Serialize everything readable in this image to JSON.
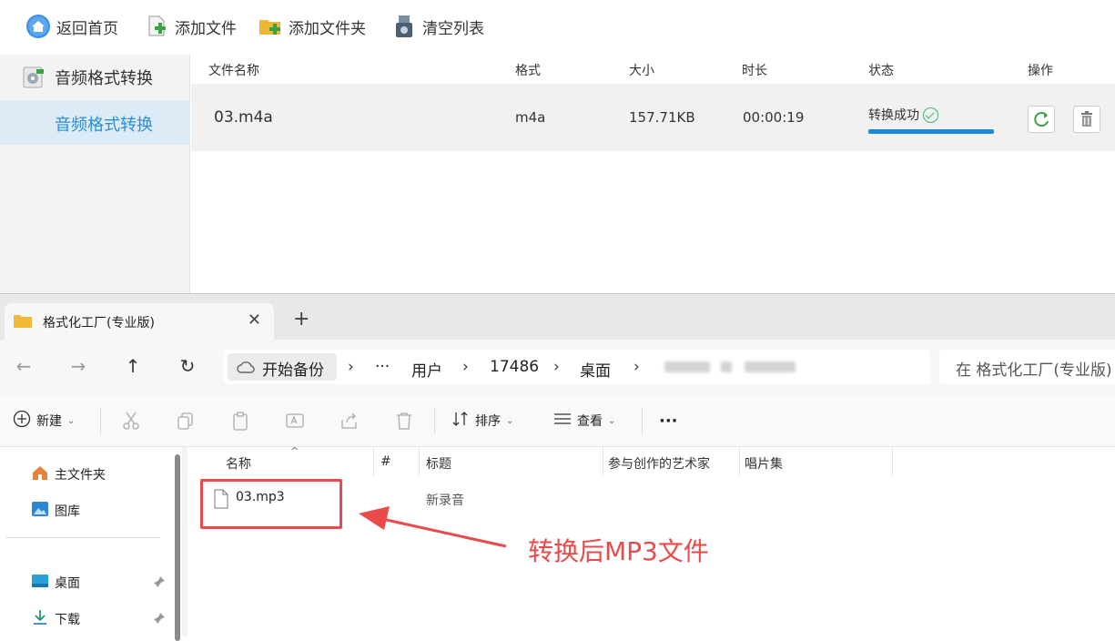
{
  "toolbar": {
    "home": "返回首页",
    "add_file": "添加文件",
    "add_folder": "添加文件夹",
    "clear_list": "清空列表"
  },
  "sidebar": {
    "group": "音频格式转换",
    "selected": "音频格式转换"
  },
  "filelist": {
    "columns": [
      "文件名称",
      "格式",
      "大小",
      "时长",
      "状态",
      "操作"
    ],
    "rows": [
      {
        "name": "03.m4a",
        "format": "m4a",
        "size": "157.71KB",
        "duration": "00:00:19",
        "status": "转换成功",
        "progress": 1.0
      }
    ]
  },
  "explorer": {
    "tab_title": "格式化工厂(专业版)",
    "new_tab": "+",
    "close": "✕",
    "breadcrumb": [
      "开始备份",
      "···",
      "用户",
      "17486",
      "桌面"
    ],
    "search_placeholder": "在 格式化工厂(专业版)",
    "commands": {
      "new": "新建",
      "sort": "排序",
      "view": "查看",
      "more": "···"
    },
    "navpane": {
      "home": "主文件夹",
      "gallery": "图库",
      "desktop": "桌面",
      "downloads": "下载"
    },
    "columns": [
      "名称",
      "#",
      "标题",
      "参与创作的艺术家",
      "唱片集"
    ],
    "files": [
      {
        "name": "03.mp3",
        "title": "新录音"
      }
    ]
  },
  "annotation": "转换后MP3文件",
  "colors": {
    "accent": "#2b8fd8",
    "progress": "#1c8ad8",
    "success": "#3cb371",
    "annotation": "#ea4a4a"
  }
}
